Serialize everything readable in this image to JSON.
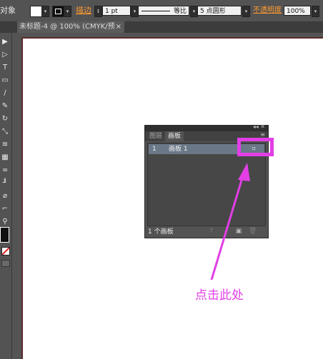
{
  "control_bar": {
    "object_label": "对象",
    "stroke_label": "描边",
    "stroke_weight": "1 pt",
    "stroke_style": "等比",
    "brush": "5 点圆形",
    "opacity_label": "不透明度",
    "opacity_value": "100%",
    "dropdown_glyph": "▾",
    "spinner_glyph": "↕"
  },
  "document_tab": {
    "title": "未标题-4 @ 100% (CMYK/预览)",
    "close": "×"
  },
  "tools": [
    {
      "icon": "selection-icon",
      "glyph": "▶"
    },
    {
      "icon": "direct-selection-icon",
      "glyph": "▷"
    },
    {
      "icon": "type-icon",
      "glyph": "T"
    },
    {
      "icon": "rectangle-icon",
      "glyph": "▭"
    },
    {
      "icon": "paintbrush-icon",
      "glyph": "∕"
    },
    {
      "icon": "pencil-icon",
      "glyph": "✎"
    },
    {
      "icon": "rotate-icon",
      "glyph": "↻"
    },
    {
      "icon": "scale-icon",
      "glyph": "⤡"
    },
    {
      "icon": "warp-icon",
      "glyph": "≋"
    },
    {
      "icon": "gradient-icon",
      "glyph": "▦"
    },
    {
      "icon": "blend-icon",
      "glyph": "∞"
    },
    {
      "icon": "graph-icon",
      "glyph": "╜"
    },
    {
      "icon": "slice-icon",
      "glyph": "⌀"
    },
    {
      "icon": "eyedropper-icon",
      "glyph": "⌐"
    },
    {
      "icon": "zoom-icon",
      "glyph": "⚲"
    },
    {
      "icon": "hand-icon",
      "glyph": "✋"
    }
  ],
  "panel": {
    "title_buttons": "◂◂  ✕",
    "tabs": [
      "图层",
      "画板"
    ],
    "active_tab": "画板",
    "menu_glyph": "≡",
    "rows": [
      {
        "num": "1",
        "name": "画板 1",
        "options_glyph": "⌗"
      }
    ],
    "footer_count": "1 个画板",
    "footer_icons": [
      "↑",
      "↓",
      "▣",
      "🗑"
    ]
  },
  "annotation": {
    "text": "点击此处",
    "color": "#e23ee6"
  },
  "colors": {
    "app_bg": "#535353",
    "canvas_bg": "#545454",
    "artboard": "#ffffff",
    "selected_row": "#6a7888",
    "highlight": "#e23ee6"
  }
}
